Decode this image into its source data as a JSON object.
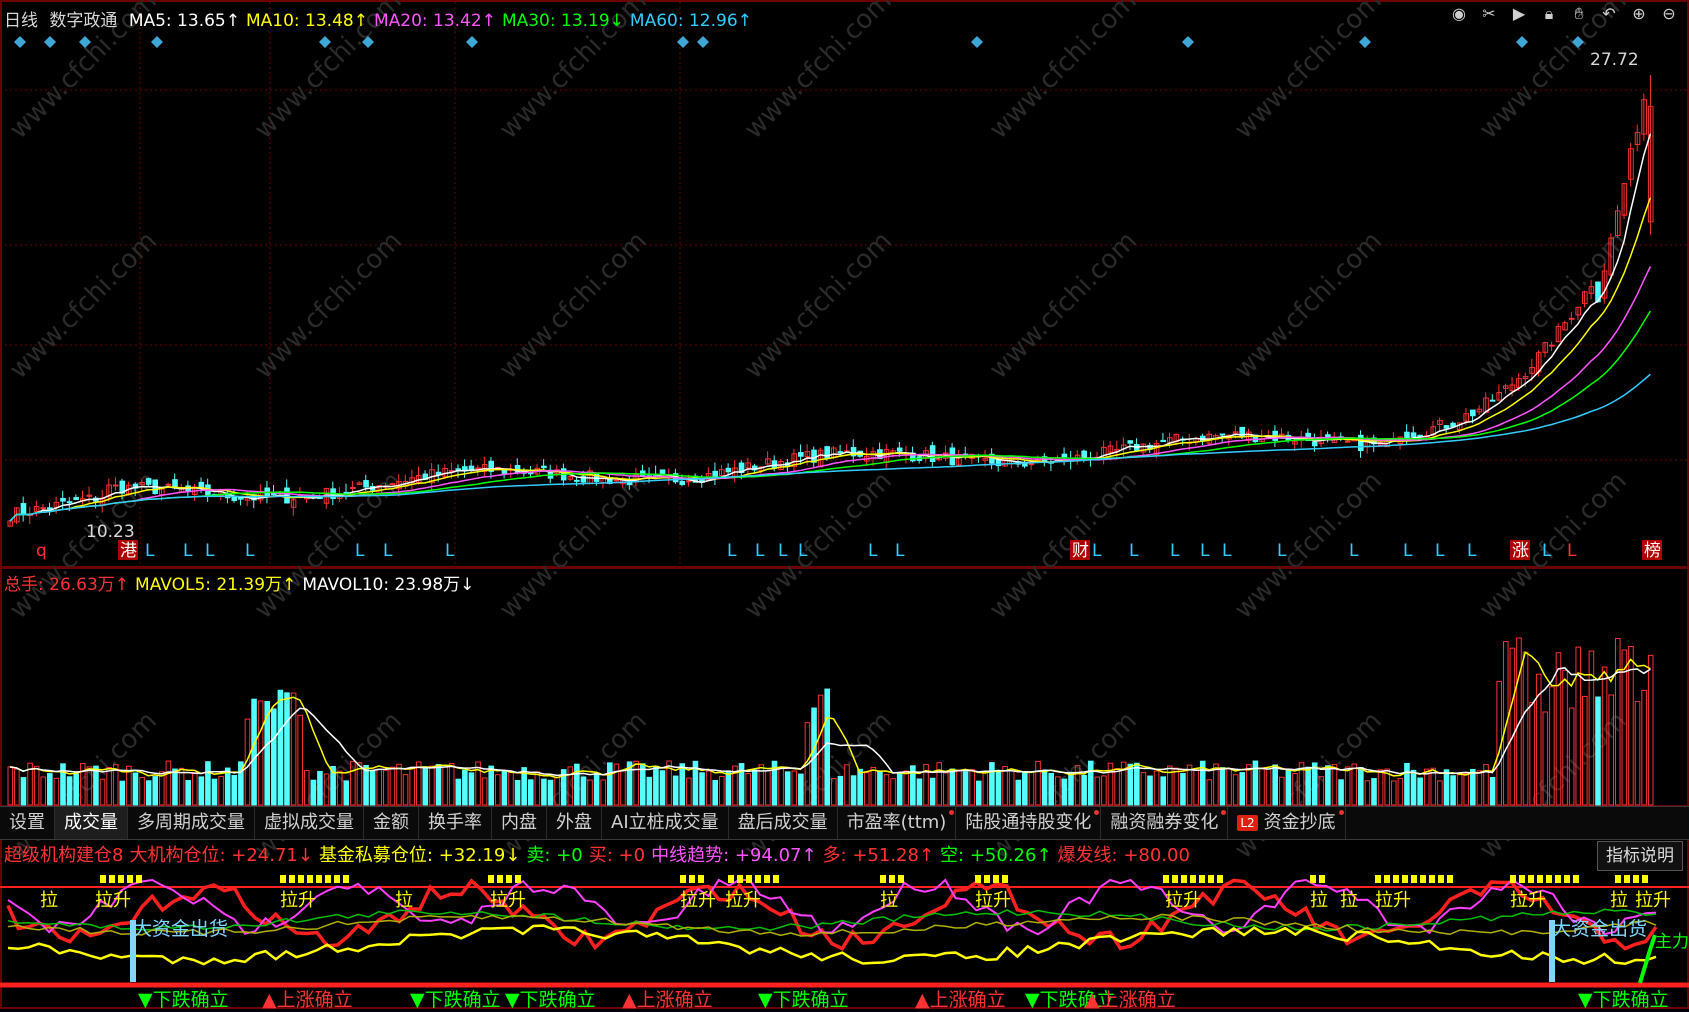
{
  "header": {
    "period": "日线",
    "stock_name": "数字政通",
    "ma": [
      {
        "label": "MA5: 13.65",
        "arrow": "↑",
        "color": "#ffffff"
      },
      {
        "label": "MA10: 13.48",
        "arrow": "↑",
        "color": "#ffff00"
      },
      {
        "label": "MA20: 13.42",
        "arrow": "↑",
        "color": "#ff55ff"
      },
      {
        "label": "MA30: 13.19",
        "arrow": "↓",
        "color": "#00ff00"
      },
      {
        "label": "MA60: 12.96",
        "arrow": "↑",
        "color": "#33ccff"
      }
    ]
  },
  "toolbar_icons": [
    "eye-icon",
    "scissors-icon",
    "play-icon",
    "lock-icon",
    "hand-icon",
    "undo-icon",
    "zoom-in-icon",
    "zoom-out-icon"
  ],
  "price_panel": {
    "high_label": "27.72",
    "low_label": "10.23",
    "bottom_markers": [
      {
        "text": "q",
        "color": "#ff3333"
      },
      {
        "text": "港",
        "color": "#ffffff",
        "boxed": true
      },
      {
        "text": "L",
        "color": "#33ccff"
      },
      {
        "text": "财",
        "color": "#ffffff",
        "boxed": true
      },
      {
        "text": "涨",
        "color": "#ffffff",
        "boxed": true
      },
      {
        "text": "榜",
        "color": "#ffffff",
        "boxed": true
      }
    ]
  },
  "volume_panel": {
    "legend": [
      {
        "label": "总手: 26.63万",
        "arrow": "↑",
        "color": "#ff3333"
      },
      {
        "label": "MAVOL5: 21.39万",
        "arrow": "↑",
        "color": "#ffff00"
      },
      {
        "label": "MAVOL10: 23.98万",
        "arrow": "↓",
        "color": "#ffffff"
      }
    ]
  },
  "tabs": [
    {
      "label": "设置",
      "dot": false
    },
    {
      "label": "成交量",
      "dot": false,
      "active": true
    },
    {
      "label": "多周期成交量",
      "dot": false
    },
    {
      "label": "虚拟成交量",
      "dot": false
    },
    {
      "label": "金额",
      "dot": false
    },
    {
      "label": "换手率",
      "dot": false
    },
    {
      "label": "内盘",
      "dot": false
    },
    {
      "label": "外盘",
      "dot": false
    },
    {
      "label": "AI立桩成交量",
      "dot": false
    },
    {
      "label": "盘后成交量",
      "dot": false
    },
    {
      "label": "市盈率(ttm)",
      "dot": true
    },
    {
      "label": "陆股通持股变化",
      "dot": true
    },
    {
      "label": "融资融券变化",
      "dot": true
    },
    {
      "label": "资金抄底",
      "dot": true,
      "badge": "L2"
    }
  ],
  "indicator_panel": {
    "legend": [
      {
        "label": "超级机构建仓8",
        "color": "#ff3333"
      },
      {
        "label": "大机构仓位: +24.71",
        "arrow": "↓",
        "color": "#ff3333"
      },
      {
        "label": "基金私募仓位: +32.19",
        "arrow": "↓",
        "color": "#ffff00"
      },
      {
        "label": "卖: +0",
        "color": "#00ff00"
      },
      {
        "label": "买: +0",
        "color": "#ff3333"
      },
      {
        "label": "中线趋势: +94.07",
        "arrow": "↑",
        "color": "#ff55ff"
      },
      {
        "label": "多: +51.28",
        "arrow": "↑",
        "color": "#ff3333"
      },
      {
        "label": "空: +50.26",
        "arrow": "↑",
        "color": "#00ff00"
      },
      {
        "label": "爆发线: +80.00",
        "color": "#ff3333"
      }
    ],
    "help_button": "指标说明",
    "labels": {
      "pull": "拉",
      "pull_up": "拉升",
      "big_outflow": "大资金出货",
      "main_force": "主力",
      "fall_confirmed": "▼下跌确立",
      "rise_confirmed": "▲上涨确立"
    }
  },
  "watermark": "www.cfchi.com",
  "colors": {
    "up": "#ff3232",
    "down": "#54ffff",
    "grid": "#6b0000"
  }
}
